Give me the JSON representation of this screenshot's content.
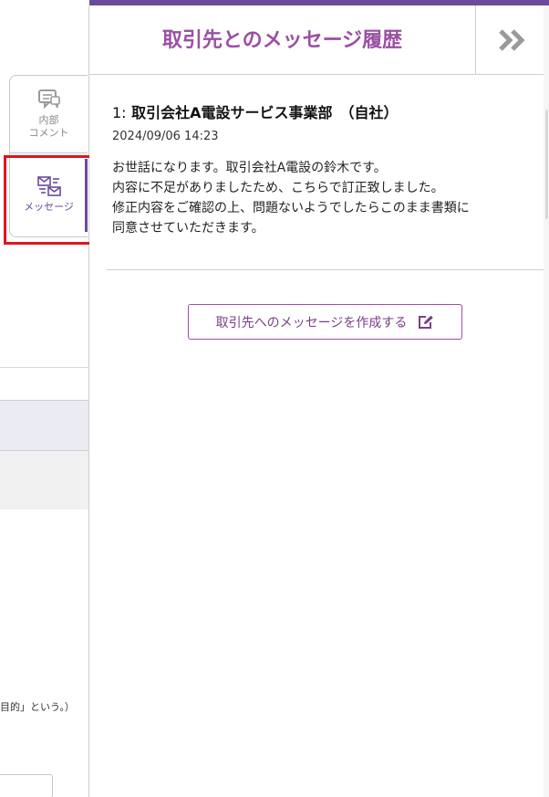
{
  "sidebar": {
    "tabs": [
      {
        "label_line1": "内部",
        "label_line2": "コメント",
        "icon": "comment-icon"
      },
      {
        "label": "メッセージ",
        "icon": "message-exchange-icon"
      }
    ]
  },
  "background_doc": {
    "snippet": "目的」という。）"
  },
  "panel": {
    "title": "取引先とのメッセージ履歴",
    "collapse_icon": "double-chevron-right-icon"
  },
  "messages": [
    {
      "number": "1:",
      "sender": "取引会社A電設サービス事業部　（自社）",
      "datetime": "2024/09/06 14:23",
      "body_lines": [
        "お世話になります。取引会社A電設の鈴木です。",
        "内容に不足がありましたため、こちらで訂正致しました。",
        "修正内容をご確認の上、問題ないようでしたらこのまま書類に",
        "同意させていただきます。"
      ]
    }
  ],
  "compose": {
    "label": "取引先へのメッセージを作成する",
    "icon": "edit-icon"
  },
  "colors": {
    "accent": "#9b4fa5",
    "active_tab": "#6a4a9c",
    "highlight": "#e0151b"
  }
}
